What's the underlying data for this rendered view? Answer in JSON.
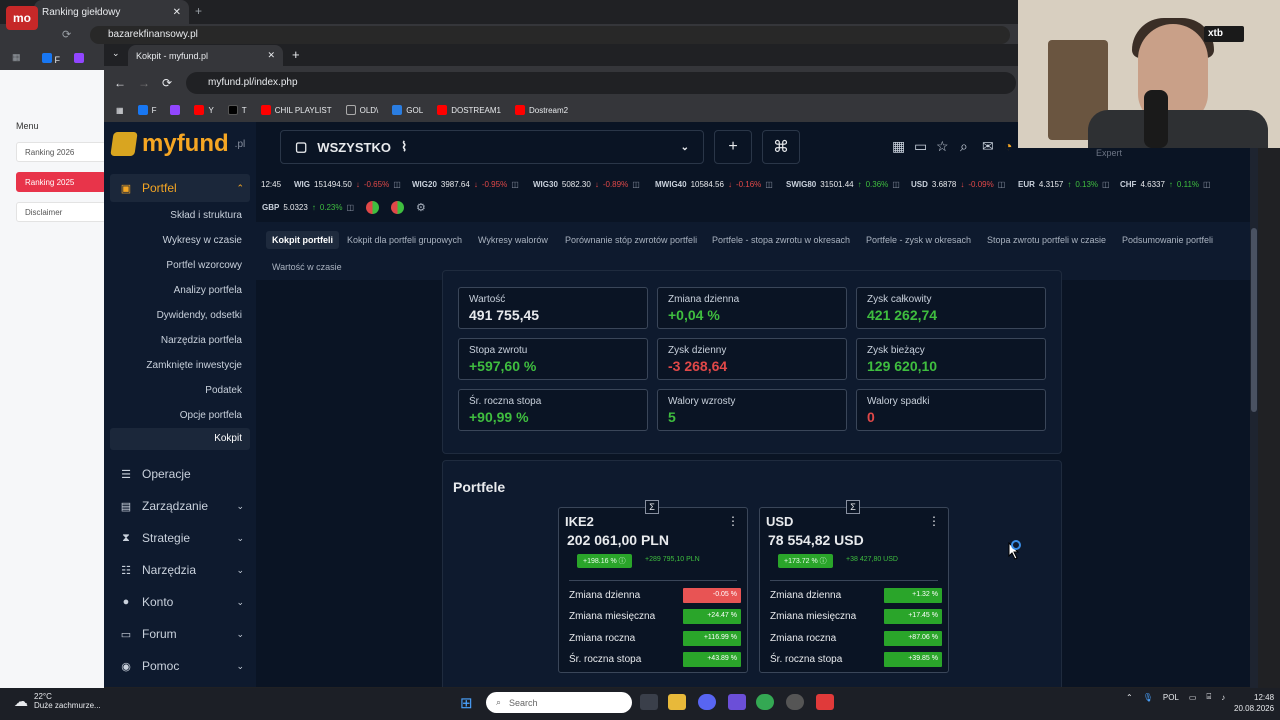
{
  "bg_browser": {
    "tab_title": "Ranking giełdowy",
    "url": "bazarekfinansowy.pl",
    "bookmarks": [
      "F",
      "T"
    ],
    "menu_title": "Menu",
    "menu_items": [
      "Ranking 2026",
      "Ranking 2025",
      "Disclaimer"
    ],
    "logo": "mo"
  },
  "browser": {
    "tab_title": "Kokpit - myfund.pl",
    "url": "myfund.pl/index.php",
    "bookmarks": [
      {
        "label": "F",
        "color": "#1877f2"
      },
      {
        "label": "",
        "color": "#9146ff"
      },
      {
        "label": "Y",
        "color": "#ff0000"
      },
      {
        "label": "T",
        "color": "#000000"
      },
      {
        "label": "CHIL PLAYLIST",
        "color": "#ff0000"
      },
      {
        "label": "OLD\\",
        "color": "#888888"
      },
      {
        "label": "GOL",
        "color": "#2a7de1"
      },
      {
        "label": "DOSTREAM1",
        "color": "#ff0000"
      },
      {
        "label": "Dostream2",
        "color": "#ff0000"
      }
    ]
  },
  "app": {
    "logo_text": "myfund",
    "logo_suffix": ".pl",
    "portfolio_select": "WSZYSTKO",
    "plus": "+",
    "cmd": "⌘",
    "expert": "Expert",
    "nav": {
      "portfel": "Portfel",
      "sub_items": [
        "Skład i struktura",
        "Wykresy w czasie",
        "Portfel wzorcowy",
        "Analizy portfela",
        "Dywidendy, odsetki",
        "Narzędzia portfela",
        "Zamknięte inwestycje",
        "Podatek",
        "Opcje portfela",
        "Kokpit"
      ],
      "groups": [
        "Operacje",
        "Zarządzanie",
        "Strategie",
        "Narzędzia",
        "Konto",
        "Forum",
        "Pomoc"
      ]
    },
    "ticker": {
      "time": "12:45",
      "items": [
        {
          "name": "WIG",
          "value": "151494.50",
          "change": "-0.65%",
          "dir": "dn"
        },
        {
          "name": "WIG20",
          "value": "3987.64",
          "change": "-0.95%",
          "dir": "dn"
        },
        {
          "name": "WIG30",
          "value": "5082.30",
          "change": "-0.89%",
          "dir": "dn"
        },
        {
          "name": "MWIG40",
          "value": "10584.56",
          "change": "-0.16%",
          "dir": "dn"
        },
        {
          "name": "SWIG80",
          "value": "31501.44",
          "change": "0.36%",
          "dir": "up"
        },
        {
          "name": "USD",
          "value": "3.6878",
          "change": "-0.09%",
          "dir": "dn"
        },
        {
          "name": "EUR",
          "value": "4.3157",
          "change": "0.13%",
          "dir": "up"
        },
        {
          "name": "CHF",
          "value": "4.6337",
          "change": "0.11%",
          "dir": "up"
        },
        {
          "name": "GBP",
          "value": "5.0323",
          "change": "0.23%",
          "dir": "up"
        }
      ]
    },
    "subnav": [
      "Kokpit portfeli",
      "Kokpit dla portfeli grupowych",
      "Wykresy walorów",
      "Porównanie stóp zwrotów portfeli",
      "Portfele - stopa zwrotu w okresach",
      "Portfele - zysk w okresach",
      "Stopa zwrotu portfeli w czasie",
      "Podsumowanie portfeli",
      "Wartość w czasie"
    ],
    "stats": [
      {
        "label": "Wartość",
        "value": "491 755,45",
        "color": "wh"
      },
      {
        "label": "Zmiana dzienna",
        "value": "+0,04 %",
        "color": "gr"
      },
      {
        "label": "Zysk całkowity",
        "value": "421 262,74",
        "color": "gr"
      },
      {
        "label": "Stopa zwrotu",
        "value": "+597,60 %",
        "color": "gr"
      },
      {
        "label": "Zysk dzienny",
        "value": "-3 268,64",
        "color": "rd"
      },
      {
        "label": "Zysk bieżący",
        "value": "129 620,10",
        "color": "gr"
      },
      {
        "label": "Śr. roczna stopa",
        "value": "+90,99 %",
        "color": "gr"
      },
      {
        "label": "Walory wzrosty",
        "value": "5",
        "color": "gr"
      },
      {
        "label": "Walory spadki",
        "value": "0",
        "color": "rd"
      }
    ],
    "portfele_title": "Portfele",
    "portfolios": [
      {
        "name": "IKE2",
        "value": "202 061,00 PLN",
        "rate": "+198.16 %",
        "gain": "+289 795,10 PLN",
        "rows": [
          {
            "label": "Zmiana dzienna",
            "val": "-0.05 %",
            "c": "r"
          },
          {
            "label": "Zmiana miesięczna",
            "val": "+24.47 %",
            "c": "g"
          },
          {
            "label": "Zmiana roczna",
            "val": "+116.99 %",
            "c": "g"
          },
          {
            "label": "Śr. roczna stopa",
            "val": "+43.89 %",
            "c": "g"
          }
        ]
      },
      {
        "name": "USD",
        "value": "78 554,82 USD",
        "rate": "+173.72 %",
        "gain": "+38 427,80 USD",
        "rows": [
          {
            "label": "Zmiana dzienna",
            "val": "+1.32 %",
            "c": "g"
          },
          {
            "label": "Zmiana miesięczna",
            "val": "+17.45 %",
            "c": "g"
          },
          {
            "label": "Zmiana roczna",
            "val": "+87.06 %",
            "c": "g"
          },
          {
            "label": "Śr. roczna stopa",
            "val": "+39.85 %",
            "c": "g"
          }
        ]
      }
    ]
  },
  "overlay": {
    "xtb": "xtb"
  },
  "taskbar": {
    "temp": "22°C",
    "weather": "Duże zachmurze...",
    "search": "Search",
    "lang": "POL",
    "time": "12:48",
    "date": "20.08.2026"
  }
}
